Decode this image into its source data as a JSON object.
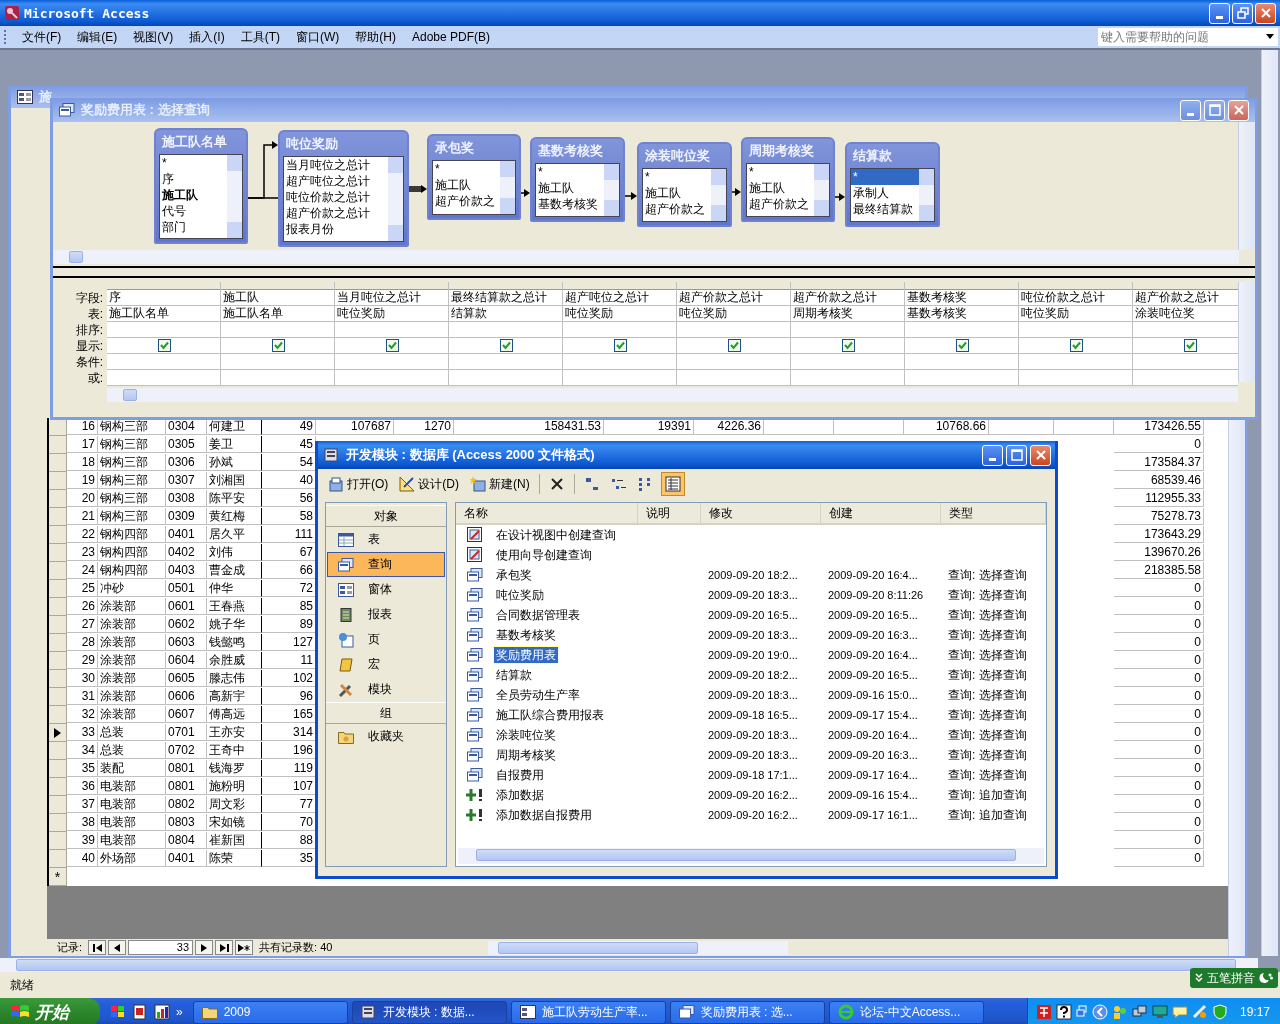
{
  "app": {
    "title": "Microsoft Access"
  },
  "menu": [
    "文件(F)",
    "编辑(E)",
    "视图(V)",
    "插入(I)",
    "工具(T)",
    "窗口(W)",
    "帮助(H)",
    "Adobe PDF(B)"
  ],
  "help_box": {
    "placeholder": "键入需要帮助的问题"
  },
  "datasheet": {
    "title": "施",
    "rows": [
      {
        "seq": "16",
        "dept": "钢构三部",
        "code": "0304",
        "name": "何建卫",
        "col_5": "49",
        "col_6": "107687",
        "col_7": "1270",
        "col_8": "158431.53",
        "col_9": "19391",
        "col_10": "4226.36",
        "col_13": "10768.66",
        "last": "173426.55",
        "selected": false
      },
      {
        "seq": "17",
        "dept": "钢构三部",
        "code": "0305",
        "name": "姜卫",
        "col_5": "45",
        "last": "0",
        "selected": false
      },
      {
        "seq": "18",
        "dept": "钢构三部",
        "code": "0306",
        "name": "孙斌",
        "col_5": "54",
        "last": "173584.37",
        "selected": false
      },
      {
        "seq": "19",
        "dept": "钢构三部",
        "code": "0307",
        "name": "刘湘国",
        "col_5": "40",
        "last": "68539.46",
        "selected": false
      },
      {
        "seq": "20",
        "dept": "钢构三部",
        "code": "0308",
        "name": "陈平安",
        "col_5": "56",
        "last": "112955.33",
        "selected": false
      },
      {
        "seq": "21",
        "dept": "钢构三部",
        "code": "0309",
        "name": "黄红梅",
        "col_5": "58",
        "last": "75278.73",
        "selected": false
      },
      {
        "seq": "22",
        "dept": "钢构四部",
        "code": "0401",
        "name": "居久平",
        "col_5": "111",
        "last": "173643.29",
        "selected": false
      },
      {
        "seq": "23",
        "dept": "钢构四部",
        "code": "0402",
        "name": "刘伟",
        "col_5": "67",
        "last": "139670.26",
        "selected": false
      },
      {
        "seq": "24",
        "dept": "钢构四部",
        "code": "0403",
        "name": "曹金成",
        "col_5": "66",
        "last": "218385.58",
        "selected": false
      },
      {
        "seq": "25",
        "dept": "冲砂",
        "code": "0501",
        "name": "仲华",
        "col_5": "72",
        "last": "0",
        "selected": false
      },
      {
        "seq": "26",
        "dept": "涂装部",
        "code": "0601",
        "name": "王春燕",
        "col_5": "85",
        "last": "0",
        "selected": false
      },
      {
        "seq": "27",
        "dept": "涂装部",
        "code": "0602",
        "name": "姚子华",
        "col_5": "89",
        "last": "0",
        "selected": false
      },
      {
        "seq": "28",
        "dept": "涂装部",
        "code": "0603",
        "name": "钱懿鸣",
        "col_5": "127",
        "last": "0",
        "selected": false
      },
      {
        "seq": "29",
        "dept": "涂装部",
        "code": "0604",
        "name": "余胜威",
        "col_5": "11",
        "last": "0",
        "selected": false
      },
      {
        "seq": "30",
        "dept": "涂装部",
        "code": "0605",
        "name": "滕志伟",
        "col_5": "102",
        "last": "0",
        "selected": false
      },
      {
        "seq": "31",
        "dept": "涂装部",
        "code": "0606",
        "name": "高新宇",
        "col_5": "96",
        "last": "0",
        "selected": false
      },
      {
        "seq": "32",
        "dept": "涂装部",
        "code": "0607",
        "name": "傅高远",
        "col_5": "165",
        "last": "0",
        "selected": false
      },
      {
        "seq": "33",
        "dept": "总装",
        "code": "0701",
        "name": "王亦安",
        "col_5": "314",
        "last": "0",
        "selected": true
      },
      {
        "seq": "34",
        "dept": "总装",
        "code": "0702",
        "name": "王奇中",
        "col_5": "196",
        "last": "0",
        "selected": false
      },
      {
        "seq": "35",
        "dept": "装配",
        "code": "0801",
        "name": "钱海罗",
        "col_5": "119",
        "last": "0",
        "selected": false
      },
      {
        "seq": "36",
        "dept": "电装部",
        "code": "0801",
        "name": "施粉明",
        "col_5": "107",
        "last": "0",
        "selected": false
      },
      {
        "seq": "37",
        "dept": "电装部",
        "code": "0802",
        "name": "周文彩",
        "col_5": "77",
        "last": "0",
        "selected": false
      },
      {
        "seq": "38",
        "dept": "电装部",
        "code": "0803",
        "name": "宋如镜",
        "col_5": "70",
        "last": "0",
        "selected": false
      },
      {
        "seq": "39",
        "dept": "电装部",
        "code": "0804",
        "name": "崔新国",
        "col_5": "88",
        "last": "0",
        "selected": false
      },
      {
        "seq": "40",
        "dept": "外场部",
        "code": "0401",
        "name": "陈荣",
        "col_5": "35",
        "last": "0",
        "selected": false
      }
    ],
    "new_row_mark": "*",
    "nav": {
      "label": "记录:",
      "current": "33",
      "total": "共有记录数: 40"
    }
  },
  "query_window": {
    "title": "奖励费用表 : 选择查询",
    "tables": [
      {
        "title": "施工队名单",
        "fields": [
          {
            "name": "*",
            "key": false,
            "selected": false
          },
          {
            "name": "序",
            "key": false,
            "selected": false
          },
          {
            "name": "施工队",
            "key": true,
            "selected": false
          },
          {
            "name": "代号",
            "key": false,
            "selected": false
          },
          {
            "name": "部门",
            "key": false,
            "selected": false
          }
        ]
      },
      {
        "title": "吨位奖励",
        "fields": [
          {
            "name": "当月吨位之总计",
            "key": false,
            "selected": false
          },
          {
            "name": "超产吨位之总计",
            "key": false,
            "selected": false
          },
          {
            "name": "吨位价款之总计",
            "key": false,
            "selected": false
          },
          {
            "name": "超产价款之总计",
            "key": false,
            "selected": false
          },
          {
            "name": "报表月份",
            "key": false,
            "selected": false
          }
        ]
      },
      {
        "title": "承包奖",
        "fields": [
          {
            "name": "*",
            "key": false,
            "selected": false
          },
          {
            "name": "施工队",
            "key": false,
            "selected": false
          },
          {
            "name": "超产价款之",
            "key": false,
            "selected": false
          }
        ]
      },
      {
        "title": "基数考核奖",
        "fields": [
          {
            "name": "*",
            "key": false,
            "selected": false
          },
          {
            "name": "施工队",
            "key": false,
            "selected": false
          },
          {
            "name": "基数考核奖",
            "key": false,
            "selected": false
          }
        ]
      },
      {
        "title": "涂装吨位奖",
        "fields": [
          {
            "name": "*",
            "key": false,
            "selected": false
          },
          {
            "name": "施工队",
            "key": false,
            "selected": false
          },
          {
            "name": "超产价款之",
            "key": false,
            "selected": false
          }
        ]
      },
      {
        "title": "周期考核奖",
        "fields": [
          {
            "name": "*",
            "key": false,
            "selected": false
          },
          {
            "name": "施工队",
            "key": false,
            "selected": false
          },
          {
            "name": "超产价款之",
            "key": false,
            "selected": false
          }
        ]
      },
      {
        "title": "结算款",
        "fields": [
          {
            "name": "*",
            "key": false,
            "selected": true
          },
          {
            "name": "承制人",
            "key": false,
            "selected": false
          },
          {
            "name": "最终结算款",
            "key": false,
            "selected": false
          }
        ]
      }
    ],
    "grid": {
      "row_labels": [
        "字段:",
        "表:",
        "排序:",
        "显示:",
        "条件:",
        "或:"
      ],
      "columns": [
        {
          "field": "序",
          "table": "施工队名单",
          "show": true
        },
        {
          "field": "施工队",
          "table": "施工队名单",
          "show": true
        },
        {
          "field": "当月吨位之总计",
          "table": "吨位奖励",
          "show": true
        },
        {
          "field": "最终结算款之总计",
          "table": "结算款",
          "show": true
        },
        {
          "field": "超产吨位之总计",
          "table": "吨位奖励",
          "show": true
        },
        {
          "field": "超产价款之总计",
          "table": "吨位奖励",
          "show": true
        },
        {
          "field": "超产价款之总计",
          "table": "周期考核奖",
          "show": true
        },
        {
          "field": "基数考核奖",
          "table": "基数考核奖",
          "show": true
        },
        {
          "field": "吨位价款之总计",
          "table": "吨位奖励",
          "show": true
        },
        {
          "field": "超产价款之总计",
          "table": "涂装吨位奖",
          "show": true
        }
      ]
    }
  },
  "db_window": {
    "title": "开发模块 : 数据库 (Access 2000 文件格式)",
    "toolbar": [
      {
        "label": "打开(O)",
        "kind": "open"
      },
      {
        "label": "设计(D)",
        "kind": "design"
      },
      {
        "label": "新建(N)",
        "kind": "new"
      }
    ],
    "view_buttons": [
      {
        "kind": "large-icons",
        "selected": false
      },
      {
        "kind": "small-icons",
        "selected": false
      },
      {
        "kind": "list",
        "selected": false
      },
      {
        "kind": "details",
        "selected": true
      }
    ],
    "objects_header": "对象",
    "objects": [
      {
        "label": "表",
        "kind": "table",
        "selected": false
      },
      {
        "label": "查询",
        "kind": "query",
        "selected": true
      },
      {
        "label": "窗体",
        "kind": "form",
        "selected": false
      },
      {
        "label": "报表",
        "kind": "report",
        "selected": false
      },
      {
        "label": "页",
        "kind": "page",
        "selected": false
      },
      {
        "label": "宏",
        "kind": "macro",
        "selected": false
      },
      {
        "label": "模块",
        "kind": "module",
        "selected": false
      }
    ],
    "groups_header": "组",
    "groups": [
      {
        "label": "收藏夹"
      }
    ],
    "columns": [
      "名称",
      "说明",
      "修改",
      "创建",
      "类型"
    ],
    "items": [
      {
        "name": "在设计视图中创建查询",
        "kind": "wizard",
        "selected": false
      },
      {
        "name": "使用向导创建查询",
        "kind": "wizard",
        "selected": false
      },
      {
        "name": "承包奖",
        "kind": "select",
        "modified": "2009-09-20 18:2...",
        "created": "2009-09-20 16:4...",
        "type": "查询: 选择查询",
        "selected": false
      },
      {
        "name": "吨位奖励",
        "kind": "select",
        "modified": "2009-09-20 18:3...",
        "created": "2009-09-20 8:11:26",
        "type": "查询: 选择查询",
        "selected": false
      },
      {
        "name": "合同数据管理表",
        "kind": "select",
        "modified": "2009-09-20 16:5...",
        "created": "2009-09-20 16:5...",
        "type": "查询: 选择查询",
        "selected": false
      },
      {
        "name": "基数考核奖",
        "kind": "select",
        "modified": "2009-09-20 18:3...",
        "created": "2009-09-20 16:3...",
        "type": "查询: 选择查询",
        "selected": false
      },
      {
        "name": "奖励费用表",
        "kind": "select",
        "modified": "2009-09-20 19:0...",
        "created": "2009-09-20 16:4...",
        "type": "查询: 选择查询",
        "selected": true
      },
      {
        "name": "结算款",
        "kind": "select",
        "modified": "2009-09-20 18:2...",
        "created": "2009-09-20 16:5...",
        "type": "查询: 选择查询",
        "selected": false
      },
      {
        "name": "全员劳动生产率",
        "kind": "select",
        "modified": "2009-09-20 18:3...",
        "created": "2009-09-16 15:0...",
        "type": "查询: 选择查询",
        "selected": false
      },
      {
        "name": "施工队综合费用报表",
        "kind": "select",
        "modified": "2009-09-18 16:5...",
        "created": "2009-09-17 15:4...",
        "type": "查询: 选择查询",
        "selected": false
      },
      {
        "name": "涂装吨位奖",
        "kind": "select",
        "modified": "2009-09-20 18:3...",
        "created": "2009-09-20 16:4...",
        "type": "查询: 选择查询",
        "selected": false
      },
      {
        "name": "周期考核奖",
        "kind": "select",
        "modified": "2009-09-20 18:3...",
        "created": "2009-09-20 16:3...",
        "type": "查询: 选择查询",
        "selected": false
      },
      {
        "name": "自报费用",
        "kind": "select",
        "modified": "2009-09-18 17:1...",
        "created": "2009-09-17 16:4...",
        "type": "查询: 选择查询",
        "selected": false
      },
      {
        "name": "添加数据",
        "kind": "append",
        "modified": "2009-09-20 16:2...",
        "created": "2009-09-16 15:4...",
        "type": "查询: 追加查询",
        "selected": false
      },
      {
        "name": "添加数据自报费用",
        "kind": "append",
        "modified": "2009-09-20 16:2...",
        "created": "2009-09-17 16:1...",
        "type": "查询: 追加查询",
        "selected": false
      }
    ]
  },
  "status_bar": "就绪",
  "ime": "五笔拼音",
  "taskbar": {
    "start": "开始",
    "more": "»",
    "tasks": [
      {
        "label": "2009",
        "kind": "folder",
        "selected": false
      },
      {
        "label": "开发模块 : 数据...",
        "kind": "database",
        "selected": true
      },
      {
        "label": "施工队劳动生产率...",
        "kind": "form",
        "selected": false
      },
      {
        "label": "奖励费用表 : 选...",
        "kind": "query",
        "selected": false
      },
      {
        "label": "论坛-中文Access...",
        "kind": "browser",
        "selected": false
      }
    ],
    "clock": "19:17"
  }
}
